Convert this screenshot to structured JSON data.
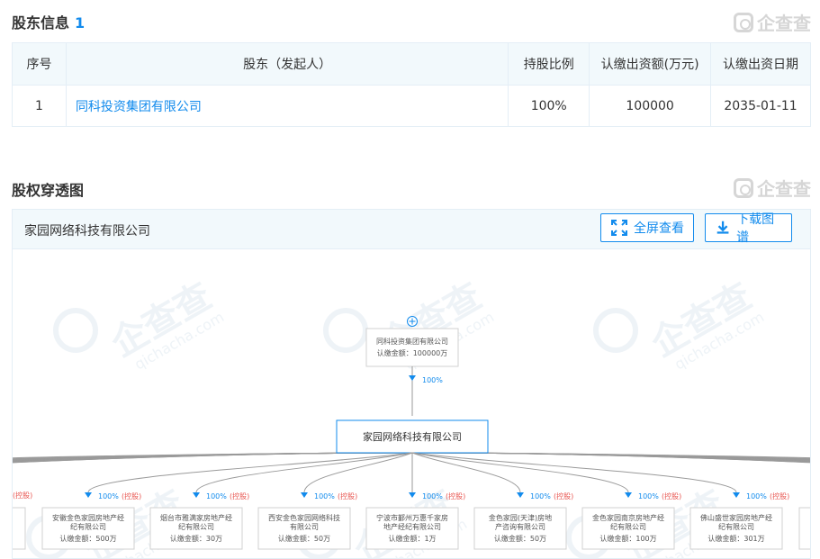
{
  "shareholders": {
    "title": "股东信息",
    "count": "1",
    "watermark": "企查查",
    "columns": [
      "序号",
      "股东（发起人）",
      "持股比例",
      "认缴出资额(万元)",
      "认缴出资日期"
    ],
    "rows": [
      {
        "index": "1",
        "name": "同科投资集团有限公司",
        "ratio": "100%",
        "amount": "100000",
        "date": "2035-01-11"
      }
    ]
  },
  "equity": {
    "title": "股权穿透图",
    "watermark": "企查查",
    "company": "家园网络科技有限公司",
    "fullscreen_label": "全屏查看",
    "download_label": "下载图谱",
    "bg_watermark": "企查查",
    "bg_watermark_url": "qichacha.com",
    "parent": {
      "name": "同科投资集团有限公司",
      "amount": "认缴金额：100000万",
      "ratio": "100%"
    },
    "center": "家园网络科技有限公司",
    "children": [
      {
        "line1": "安徽金色家园房地产经",
        "line2": "纪有限公司",
        "amount": "认缴金额：500万",
        "ratio": "100%",
        "tag": "(控股)"
      },
      {
        "line1": "烟台市雅满家房地产经",
        "line2": "纪有限公司",
        "amount": "认缴金额：30万",
        "ratio": "100%",
        "tag": "(控股)"
      },
      {
        "line1": "西安金色家园网络科技",
        "line2": "有限公司",
        "amount": "认缴金额：50万",
        "ratio": "100%",
        "tag": "(控股)"
      },
      {
        "line1": "宁波市鄞州万惠千家房",
        "line2": "地产经纪有限公司",
        "amount": "认缴金额：1万",
        "ratio": "100%",
        "tag": "(控股)"
      },
      {
        "line1": "金色家园(天津)房地",
        "line2": "产咨询有限公司",
        "amount": "认缴金额：50万",
        "ratio": "100%",
        "tag": "(控股)"
      },
      {
        "line1": "金色家园南京房地产经",
        "line2": "纪有限公司",
        "amount": "认缴金额：100万",
        "ratio": "100%",
        "tag": "(控股)"
      },
      {
        "line1": "佛山盛世家园房地产经",
        "line2": "纪有限公司",
        "amount": "认缴金额：301万",
        "ratio": "100%",
        "tag": "(控股)"
      }
    ],
    "left_edge_tag": "(控股)"
  },
  "colors": {
    "accent": "#128bed",
    "header_bg": "#f2f9fc",
    "border": "#e4eef6",
    "tag": "#e8544f"
  }
}
